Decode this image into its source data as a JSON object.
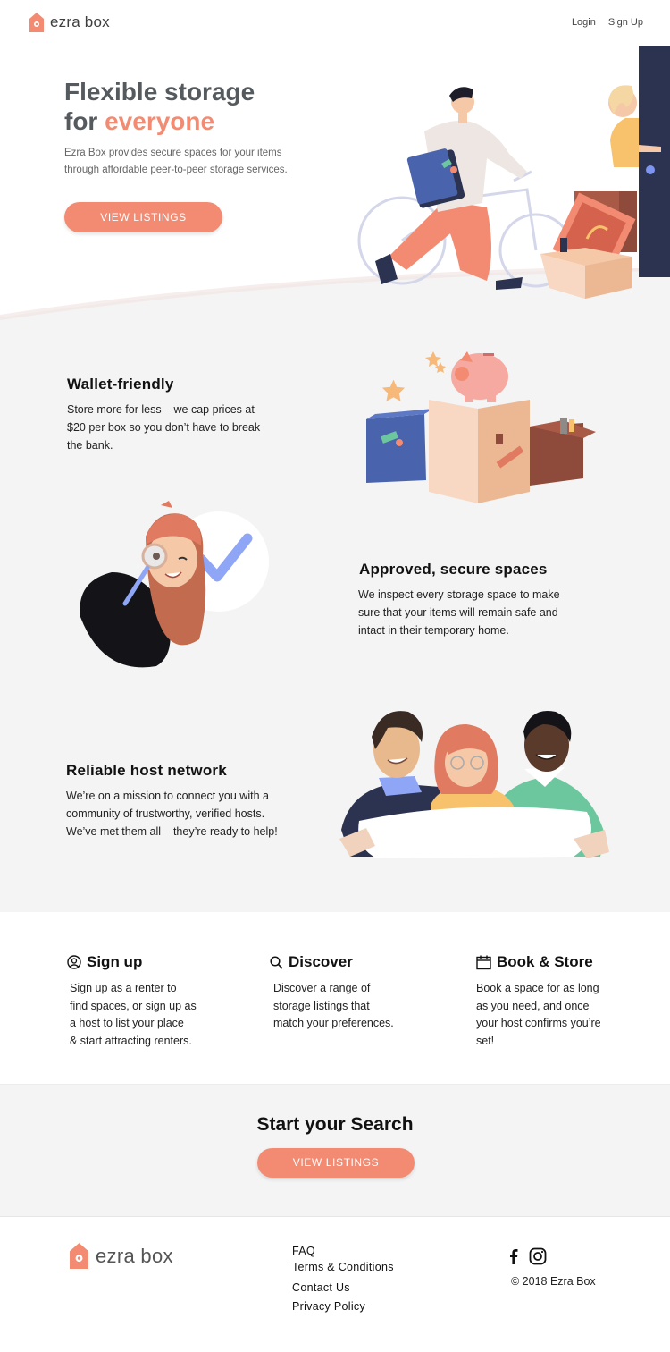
{
  "header": {
    "brand": "ezra box",
    "nav": {
      "login": "Login",
      "signup": "Sign Up"
    }
  },
  "hero": {
    "title_line1": "Flexible storage",
    "title_for": "for ",
    "title_accent": "everyone",
    "description": "Ezra Box provides secure spaces for your items through affordable peer-to-peer storage services.",
    "cta": "VIEW LISTINGS"
  },
  "features": [
    {
      "title": "Wallet-friendly",
      "lines": [
        "Store more for less – we cap prices at",
        "$20 per box so you don’t have to break",
        "the bank."
      ]
    },
    {
      "title": "Approved, secure spaces",
      "lines": [
        "We inspect every storage space to make",
        "sure that your items will remain safe and",
        "intact in their temporary home."
      ]
    },
    {
      "title": "Reliable host network",
      "lines": [
        "We’re on a mission to connect you with a",
        "community of trustworthy, verified hosts.",
        "We’ve met them all – they’re ready to help!"
      ]
    }
  ],
  "steps": [
    {
      "title": "Sign up",
      "icon": "user-circle-icon",
      "lines": [
        "Sign up as a renter to",
        "find spaces, or sign up as",
        "a host to list your place",
        "& start attracting renters."
      ]
    },
    {
      "title": "Discover",
      "icon": "search-icon",
      "lines": [
        "Discover a range of",
        "storage listings that",
        "match  your preferences."
      ]
    },
    {
      "title": "Book & Store",
      "icon": "calendar-icon",
      "lines": [
        "Book a space for as long",
        "as you need, and once",
        "your host confirms you’re",
        "set!"
      ]
    }
  ],
  "search": {
    "title": "Start your Search",
    "cta": "VIEW LISTINGS"
  },
  "footer": {
    "brand": "ezra box",
    "links": [
      "FAQ",
      "Terms & Conditions",
      "Contact Us",
      "Privacy Policy"
    ],
    "copyright": "© 2018 Ezra Box"
  },
  "colors": {
    "accent": "#f38b72",
    "band": "#f4f4f4",
    "navy": "#2b3350",
    "box_blue": "#4a63ad",
    "peach": "#f5c8a8",
    "brick": "#8e4a3a"
  }
}
